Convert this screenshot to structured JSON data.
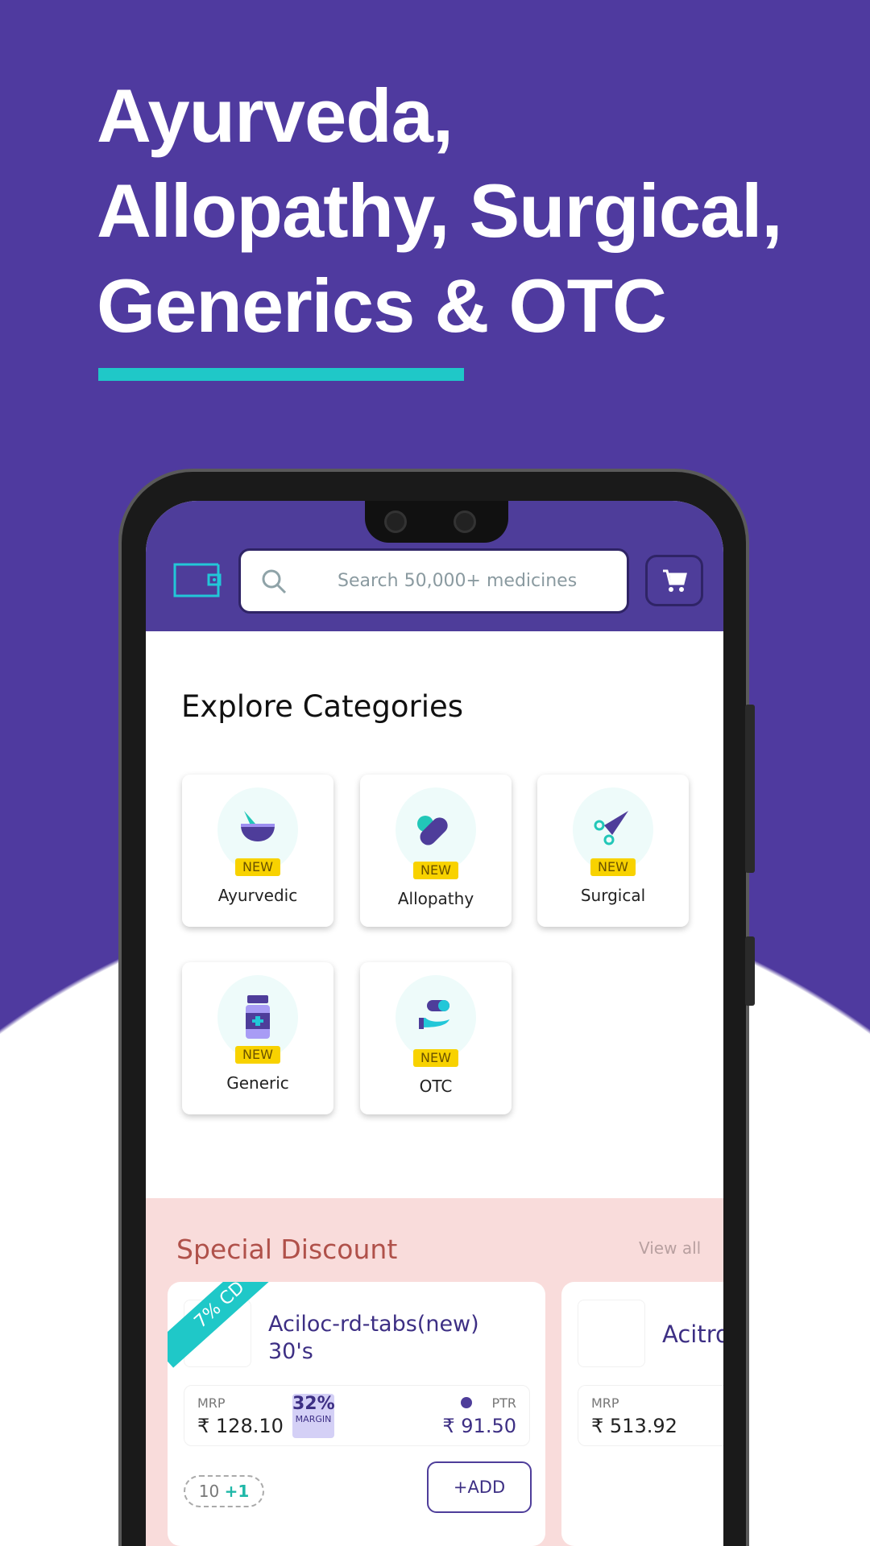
{
  "headline": {
    "lines": [
      "Ayurveda,",
      "Allopathy, Surgical,",
      "Generics & OTC"
    ]
  },
  "colors": {
    "background": "#4f3a9f",
    "accent": "#1fc8c8",
    "header": "#4e3d9a",
    "new_badge": "#f8d200",
    "discount_bg": "#f9dcdb"
  },
  "header": {
    "wallet_icon": "wallet-icon",
    "search_placeholder": "Search 50,000+ medicines",
    "cart_icon": "cart-icon"
  },
  "categories": {
    "title": "Explore Categories",
    "new_label": "NEW",
    "items": [
      {
        "label": "Ayurvedic",
        "icon": "mortar-pestle-icon"
      },
      {
        "label": "Allopathy",
        "icon": "pill-icon"
      },
      {
        "label": "Surgical",
        "icon": "scissors-icon"
      },
      {
        "label": "Generic",
        "icon": "medicine-bottle-icon"
      },
      {
        "label": "OTC",
        "icon": "hand-capsule-icon"
      }
    ]
  },
  "special_discount": {
    "title": "Special Discount",
    "view_all": "View all",
    "products": [
      {
        "badge": "7% CD",
        "name_line1": "Aciloc-rd-tabs(new)",
        "name_line2": "30's",
        "mrp_label": "MRP",
        "mrp": "₹ 128.10",
        "margin": "32%",
        "margin_label": "MARGIN",
        "ptr_label": "PTR",
        "ptr": "₹ 91.50",
        "scheme_qty": "10",
        "scheme_free": "+1",
        "add_label": "+ADD"
      },
      {
        "name_line1": "Acitro",
        "mrp_label": "MRP",
        "mrp": "₹ 513.92"
      }
    ]
  }
}
